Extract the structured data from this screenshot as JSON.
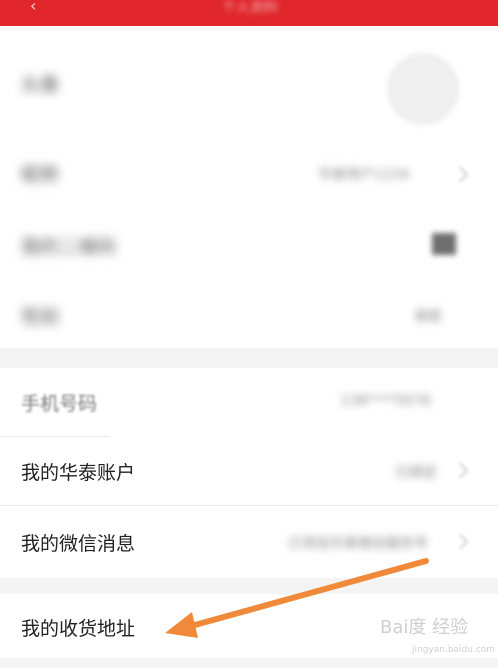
{
  "header": {
    "title": "个人资料",
    "back_icon": "chevron-left-icon"
  },
  "profile": [
    {
      "label": "头像",
      "value": ""
    },
    {
      "label": "昵称",
      "value": "华泰用户1234"
    },
    {
      "label": "我的二维码",
      "value": ""
    },
    {
      "label": "性别",
      "value": "保密"
    }
  ],
  "account": [
    {
      "label": "手机号码",
      "value": "138****5678"
    },
    {
      "label": "我的华泰账户",
      "value": "已绑定"
    },
    {
      "label": "我的微信消息",
      "value": "已添加华泰微信服务号"
    }
  ],
  "address": {
    "label": "我的收货地址"
  },
  "annotation": {
    "arrow_color": "#f08a3a"
  },
  "watermark": {
    "brand": "Bai度 经验",
    "url": "jingyan.baidu.com"
  },
  "colors": {
    "brand_red": "#e0262b"
  }
}
